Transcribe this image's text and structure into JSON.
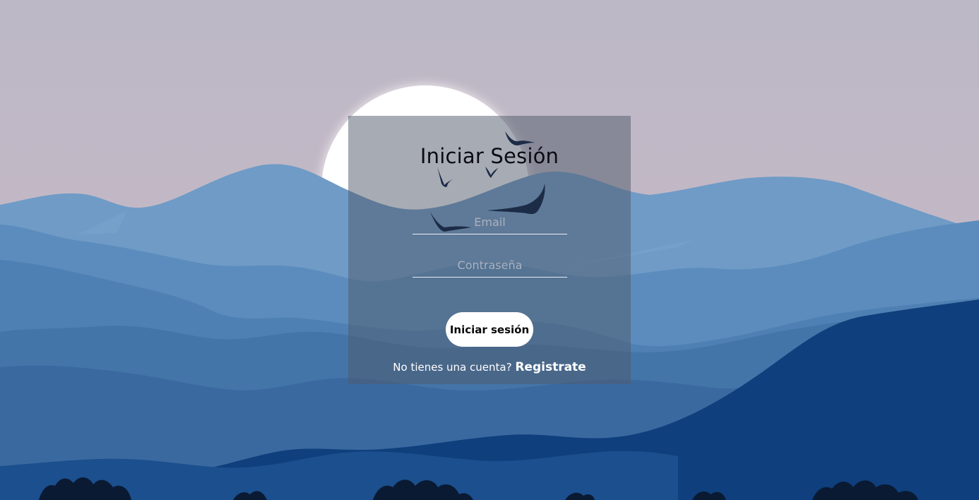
{
  "login": {
    "title": "Iniciar Sesión",
    "email_placeholder": "Email",
    "password_placeholder": "Contraseña",
    "submit_label": "Iniciar sesión",
    "register_prompt": "No tienes una cuenta?",
    "register_link": "Registrate"
  },
  "colors": {
    "sky_top": "#bcb8c6",
    "sky_bottom": "#cbb9c4",
    "moon": "#ffffff",
    "mountain_far": "#6f9bc6",
    "mountain_mid": "#4d7eb0",
    "mountain_near": "#3a69a0",
    "mountain_front": "#0f3f7c",
    "tree_silhouette": "#0a1a33",
    "bird": "#1c2c47"
  }
}
